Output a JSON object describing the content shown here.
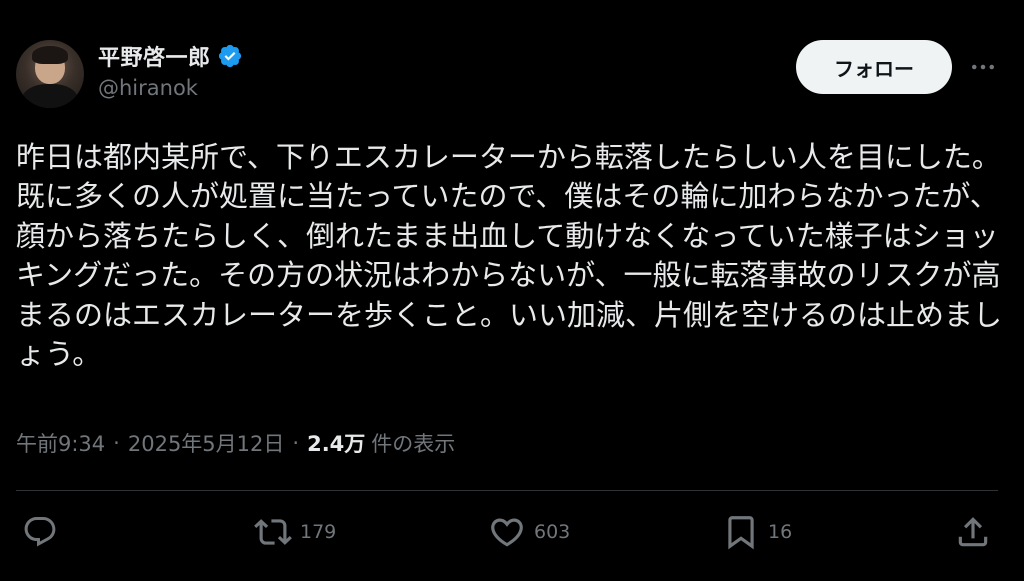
{
  "author": {
    "display_name": "平野啓一郎",
    "handle": "@hiranok",
    "verified": true,
    "avatar_icon": "profile-photo"
  },
  "follow_button": {
    "label": "フォロー"
  },
  "more_icon": "more-horizontal-icon",
  "tweet": {
    "text": "昨日は都内某所で、下りエスカレーターから転落したらしい人を目にした。既に多くの人が処置に当たっていたので、僕はその輪に加わらなかったが、顔から落ちたらしく、倒れたまま出血して動けなくなっていた様子はショッキングだった。その方の状況はわからないが、一般に転落事故のリスクが高まるのはエスカレーターを歩くこと。いい加減、片側を空けるのは止めましょう。"
  },
  "meta": {
    "time": "午前9:34",
    "separator": "·",
    "date": "2025年5月12日",
    "views_count": "2.4万",
    "views_label": "件の表示"
  },
  "actions": {
    "reply": {
      "icon": "reply-icon",
      "count": ""
    },
    "retweet": {
      "icon": "retweet-icon",
      "count": "179"
    },
    "like": {
      "icon": "heart-icon",
      "count": "603"
    },
    "bookmark": {
      "icon": "bookmark-icon",
      "count": "16"
    },
    "share": {
      "icon": "share-icon",
      "count": ""
    }
  },
  "colors": {
    "background": "#000000",
    "text_primary": "#e7e9ea",
    "text_secondary": "#71767b",
    "verified_blue": "#1d9bf0",
    "button_bg": "#eff3f4",
    "divider": "#2f3336"
  }
}
